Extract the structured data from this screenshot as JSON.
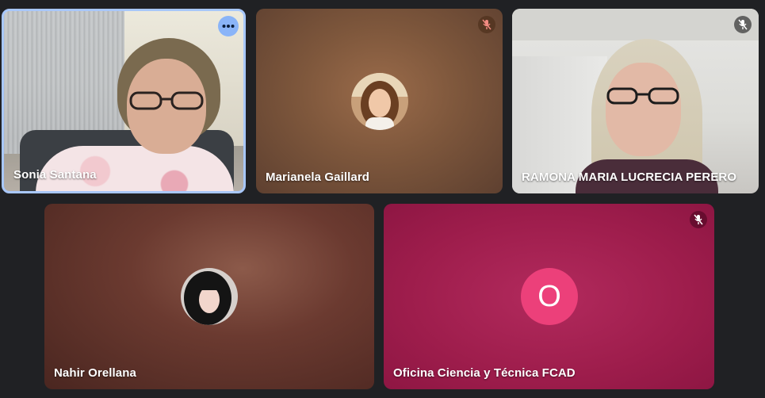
{
  "participants": [
    {
      "name": "Sonia Santana",
      "camera": "on",
      "active_speaker": true
    },
    {
      "name": "Marianela Gaillard",
      "camera": "off",
      "muted": true
    },
    {
      "name": "RAMONA MARIA LUCRECIA PERERO",
      "camera": "on",
      "muted": true
    },
    {
      "name": "Nahir Orellana",
      "camera": "off"
    },
    {
      "name": "Oficina Ciencia y Técnica FCAD",
      "camera": "off",
      "muted": true,
      "avatar_letter": "O"
    }
  ],
  "icons": {
    "more": "more-options-icon",
    "mic_off": "mic-off-icon"
  },
  "colors": {
    "active_border": "#a8c7fa",
    "more_button": "#8ab4f8",
    "letter_avatar": "#ec407a",
    "background": "#202124"
  }
}
